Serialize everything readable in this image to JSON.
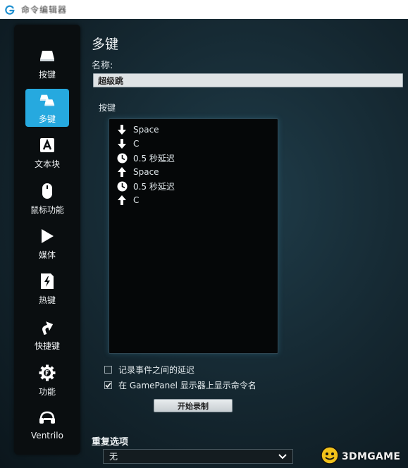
{
  "window": {
    "title": "命令编辑器"
  },
  "sidebar": {
    "items": [
      {
        "label": "按键",
        "icon": "key-icon",
        "active": false
      },
      {
        "label": "多键",
        "icon": "multikey-icon",
        "active": true
      },
      {
        "label": "文本块",
        "icon": "text-block-icon",
        "active": false
      },
      {
        "label": "鼠标功能",
        "icon": "mouse-icon",
        "active": false
      },
      {
        "label": "媒体",
        "icon": "play-icon",
        "active": false
      },
      {
        "label": "热键",
        "icon": "hotkey-icon",
        "active": false
      },
      {
        "label": "快捷键",
        "icon": "shortcut-arrow-icon",
        "active": false
      },
      {
        "label": "功能",
        "icon": "function-gear-icon",
        "active": false
      },
      {
        "label": "Ventrilo",
        "icon": "headset-icon",
        "active": false
      }
    ]
  },
  "editor": {
    "section_title": "多键",
    "name_label": "名称:",
    "name_value": "超级跳",
    "keys_label": "按键",
    "keys": [
      {
        "type": "down",
        "text": "Space"
      },
      {
        "type": "down",
        "text": "C"
      },
      {
        "type": "delay",
        "text": "0.5 秒延迟"
      },
      {
        "type": "up",
        "text": "Space"
      },
      {
        "type": "delay",
        "text": "0.5 秒延迟"
      },
      {
        "type": "up",
        "text": "C"
      }
    ],
    "options": {
      "record_delays": {
        "label": "记录事件之间的延迟",
        "checked": false
      },
      "show_name": {
        "label": "在 GamePanel 显示器上显示命令名",
        "checked": true
      }
    },
    "record_button": "开始录制",
    "repeat_label": "重复选项",
    "repeat_value": "无"
  },
  "watermark": {
    "text": "3DMGAME"
  },
  "colors": {
    "accent": "#26a9df",
    "sidebar_bg": "#0a0e10",
    "key_box_bg": "#050708"
  }
}
